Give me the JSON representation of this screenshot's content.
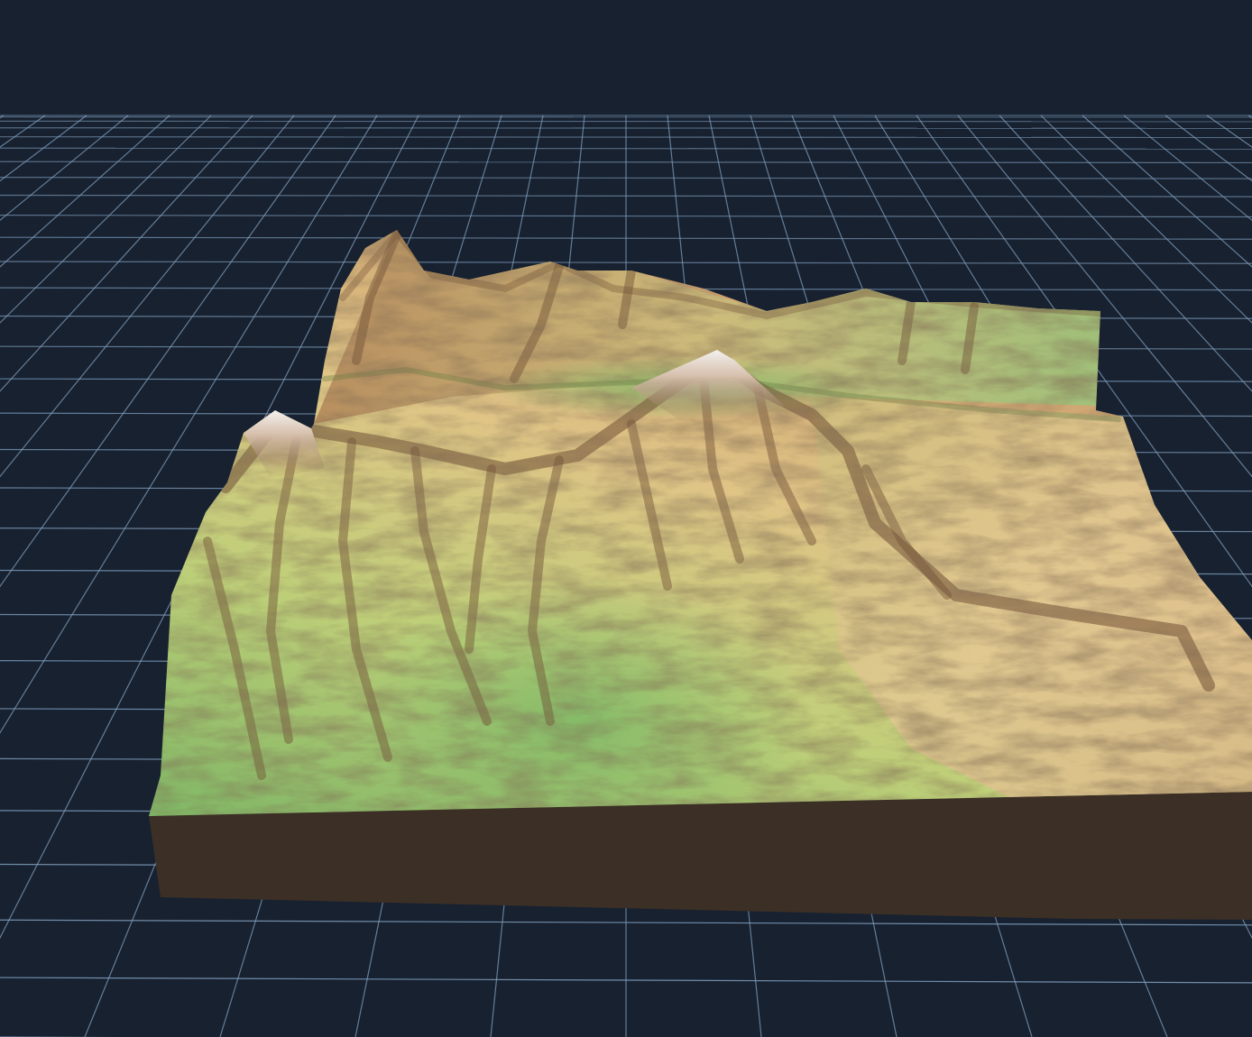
{
  "scene": {
    "subject": "3d-terrain-render",
    "colors": {
      "background": "#172130",
      "grid_line": "#7f9dbb",
      "base_side": "#3c2f26",
      "lowland_green": "#8fbf6a",
      "mid_yellow": "#d8cf86",
      "upland_tan": "#cfa06c",
      "ridge_brown": "#6f4e34",
      "peak_snow": "#f1ede8"
    },
    "grid": {
      "visible": true
    },
    "labels": []
  }
}
